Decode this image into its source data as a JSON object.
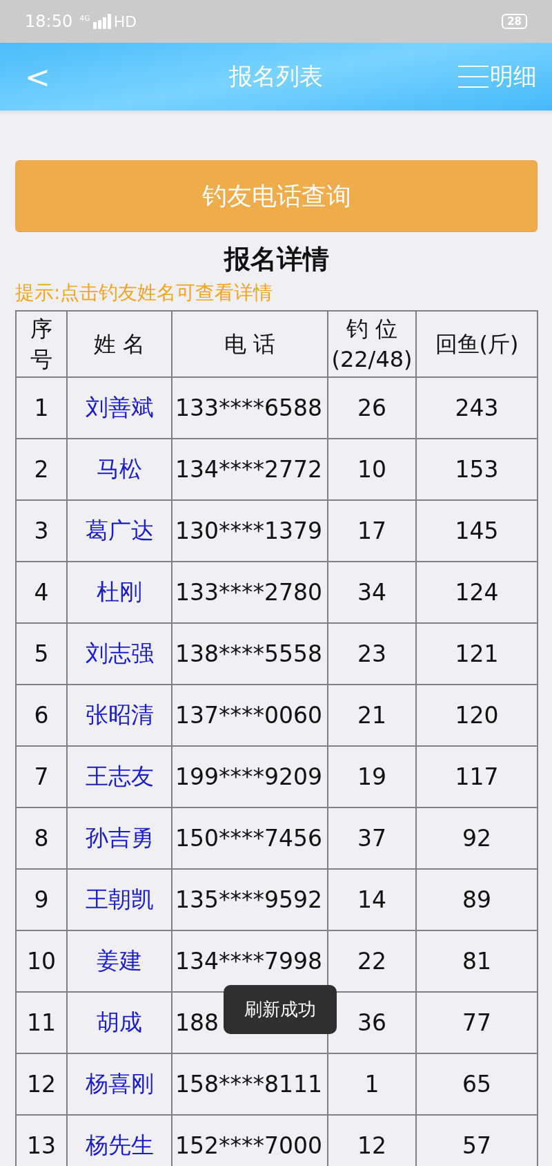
{
  "status_bar": {
    "time": "18:50",
    "network": "4G",
    "hd": "HD",
    "battery": "28"
  },
  "header": {
    "back": "<",
    "title": "报名列表",
    "menu_label": "明细"
  },
  "search_button": "钓友电话查询",
  "section_title": "报名详情",
  "hint": "提示:点击钓友姓名可查看详情",
  "table": {
    "columns": [
      "序号",
      "姓 名",
      "电 话",
      "钓 位\n(22/48)",
      "回鱼(斤)"
    ],
    "rows": [
      {
        "no": "1",
        "name": "刘善斌",
        "phone": "133****6588",
        "seat": "26",
        "catch": "243"
      },
      {
        "no": "2",
        "name": "马松",
        "phone": "134****2772",
        "seat": "10",
        "catch": "153"
      },
      {
        "no": "3",
        "name": "葛广达",
        "phone": "130****1379",
        "seat": "17",
        "catch": "145"
      },
      {
        "no": "4",
        "name": "杜刚",
        "phone": "133****2780",
        "seat": "34",
        "catch": "124"
      },
      {
        "no": "5",
        "name": "刘志强",
        "phone": "138****5558",
        "seat": "23",
        "catch": "121"
      },
      {
        "no": "6",
        "name": "张昭清",
        "phone": "137****0060",
        "seat": "21",
        "catch": "120"
      },
      {
        "no": "7",
        "name": "王志友",
        "phone": "199****9209",
        "seat": "19",
        "catch": "117"
      },
      {
        "no": "8",
        "name": "孙吉勇",
        "phone": "150****7456",
        "seat": "37",
        "catch": "92"
      },
      {
        "no": "9",
        "name": "王朝凯",
        "phone": "135****9592",
        "seat": "14",
        "catch": "89"
      },
      {
        "no": "10",
        "name": "姜建",
        "phone": "134****7998",
        "seat": "22",
        "catch": "81"
      },
      {
        "no": "11",
        "name": "胡成",
        "phone": "188",
        "seat": "36",
        "catch": "77"
      },
      {
        "no": "12",
        "name": "杨喜刚",
        "phone": "158****8111",
        "seat": "1",
        "catch": "65"
      },
      {
        "no": "13",
        "name": "杨先生",
        "phone": "152****7000",
        "seat": "12",
        "catch": "57"
      }
    ]
  },
  "toast": "刷新成功"
}
